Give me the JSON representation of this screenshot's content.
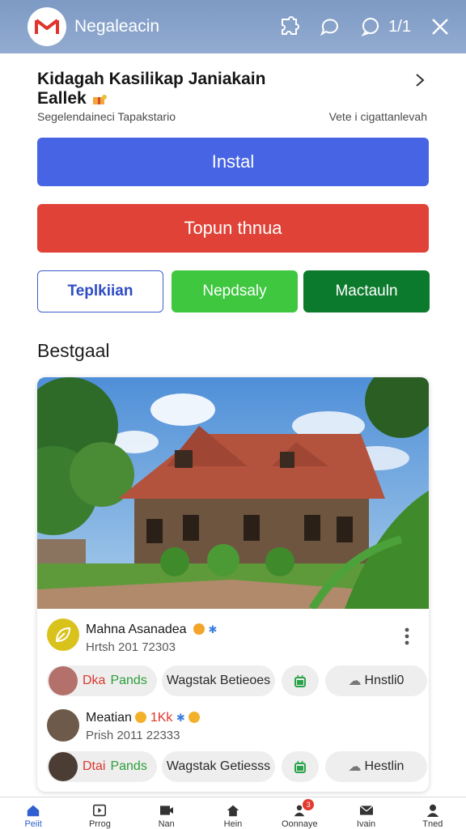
{
  "header": {
    "app_title": "Negaleacin",
    "count_text": "1/1",
    "icons": [
      "logo-icon",
      "puzzle-icon",
      "chat-bubble-icon",
      "comment-icon",
      "close-icon"
    ]
  },
  "app": {
    "title_line1": "Kidagah Kasilikap Janiakain",
    "title_line2": "Eallek",
    "developer": "Segelendaineci Tapakstario",
    "meta_right": "Vete i cigattanlevah"
  },
  "actions": {
    "install_label": "Instal",
    "secondary_label": "Topun thnua",
    "outline_label": "Teplkiian",
    "green_label": "Nepdsaly",
    "dark_label": "Mactauln"
  },
  "section": {
    "title": "Bestgaal"
  },
  "posts": [
    {
      "name": "Mahna Asanadea",
      "date": "Hrtsh 201 72303",
      "user_a": "Dka",
      "user_b": "Pands",
      "tag": "Wagstak Betieoes",
      "history": "Hnstli0"
    },
    {
      "name": "Meatian",
      "name_extra": "1Kk",
      "date": "Prish 2011 22333",
      "user_a": "Dtai",
      "user_b": "Pands",
      "tag": "Wagstak Getiesss",
      "history": "Hestlin"
    }
  ],
  "bottom_nav": [
    {
      "label": "Peiit",
      "icon": "home-icon",
      "active": true
    },
    {
      "label": "Prrog",
      "icon": "media-icon"
    },
    {
      "label": "Nan",
      "icon": "camera-icon"
    },
    {
      "label": "Hein",
      "icon": "house-icon"
    },
    {
      "label": "Oonnaye",
      "icon": "people-icon",
      "badge": "3"
    },
    {
      "label": "Ivain",
      "icon": "mail-icon"
    },
    {
      "label": "Tned",
      "icon": "person-icon"
    }
  ],
  "colors": {
    "header": "#8aa3cb",
    "install": "#4664e4",
    "red": "#e04237",
    "green": "#3ec73f",
    "dark_green": "#0c7a2c",
    "accent_blue": "#2f5fd0"
  }
}
